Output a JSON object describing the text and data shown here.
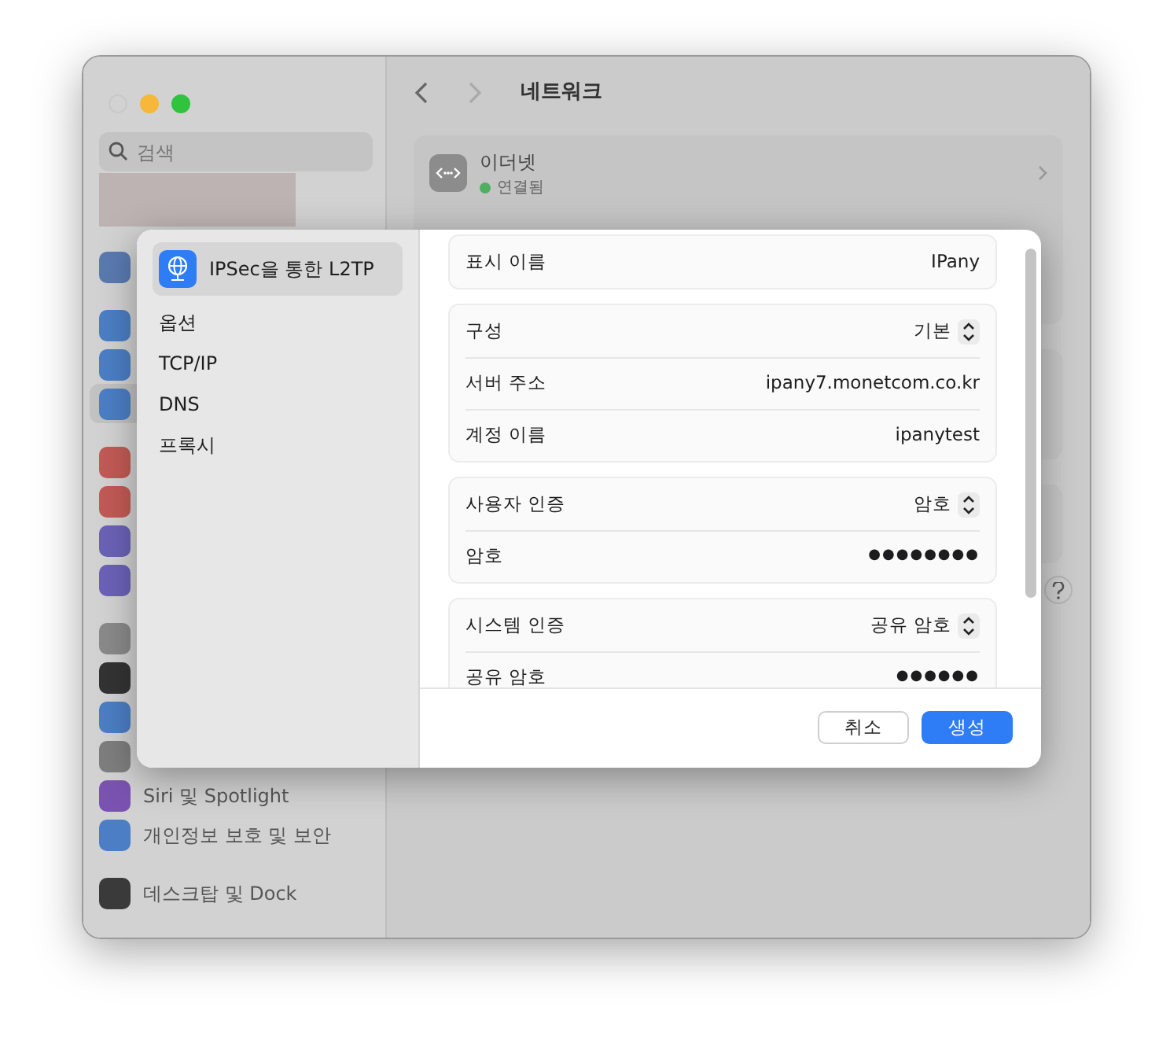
{
  "window": {
    "title": "네트워크"
  },
  "sidebar": {
    "search_placeholder": "검색",
    "groups": [
      [
        {
          "color": "#5a7ab0",
          "selected": false
        }
      ],
      [
        {
          "color": "#4b7ec4",
          "selected": false
        },
        {
          "color": "#4b7ec4",
          "selected": false
        },
        {
          "color": "#4b7ec4",
          "selected": true
        }
      ],
      [
        {
          "color": "#c25a55",
          "selected": false
        },
        {
          "color": "#c25a55",
          "selected": false
        },
        {
          "color": "#6b62b6",
          "selected": false
        },
        {
          "color": "#6b62b6",
          "selected": false
        }
      ],
      [
        {
          "color": "#8a8a8a",
          "selected": false
        },
        {
          "color": "#333333",
          "selected": false
        },
        {
          "color": "#4b7ec4",
          "selected": false
        },
        {
          "color": "#7e7e7e",
          "selected": false
        },
        {
          "color": "#7a52b0",
          "label": "Siri 및 Spotlight",
          "selected": false
        },
        {
          "color": "#4b7ec4",
          "label": "개인정보 보호 및 보안",
          "selected": false
        }
      ],
      [
        {
          "color": "#3a3a3a",
          "label": "데스크탑 및 Dock",
          "selected": false
        }
      ]
    ]
  },
  "services": [
    {
      "name": "이더넷",
      "status": "연결됨"
    }
  ],
  "sheet": {
    "nav": [
      {
        "label": "IPSec을 통한 L2TP",
        "selected": true,
        "kind": "header"
      },
      {
        "label": "옵션",
        "selected": false,
        "kind": "item"
      },
      {
        "label": "TCP/IP",
        "selected": false,
        "kind": "item"
      },
      {
        "label": "DNS",
        "selected": false,
        "kind": "item"
      },
      {
        "label": "프록시",
        "selected": false,
        "kind": "item"
      }
    ],
    "groups": [
      [
        {
          "label": "표시 이름",
          "value": "IPany",
          "kind": "text"
        }
      ],
      [
        {
          "label": "구성",
          "value": "기본",
          "kind": "popup"
        },
        {
          "label": "서버 주소",
          "value": "ipany7.monetcom.co.kr",
          "kind": "text"
        },
        {
          "label": "계정 이름",
          "value": "ipanytest",
          "kind": "text"
        }
      ],
      [
        {
          "label": "사용자 인증",
          "value": "암호",
          "kind": "popup"
        },
        {
          "label": "암호",
          "value": "●●●●●●●●",
          "kind": "secret"
        }
      ],
      [
        {
          "label": "시스템 인증",
          "value": "공유 암호",
          "kind": "popup"
        },
        {
          "label": "공유 암호",
          "value": "●●●●●●",
          "kind": "secret"
        }
      ]
    ],
    "buttons": [
      {
        "label": "취소",
        "kind": "default"
      },
      {
        "label": "생성",
        "kind": "primary"
      }
    ]
  }
}
